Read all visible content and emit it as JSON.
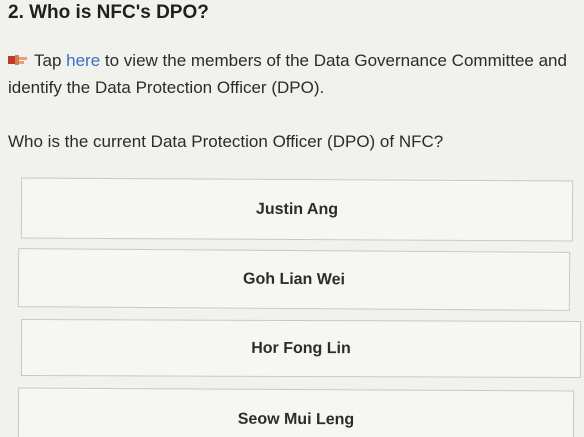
{
  "question": {
    "title": "2. Who is NFC's DPO?",
    "instruction_link": "here",
    "instruction_before": "Tap ",
    "instruction_after": " to view the members of the Data Governance Committee and identify the Data Protection Officer (DPO).",
    "prompt": "Who is the current Data Protection Officer (DPO) of NFC?"
  },
  "options": [
    "Justin Ang",
    "Goh Lian Wei",
    "Hor Fong Lin",
    "Seow Mui Leng"
  ],
  "icons": {
    "instruction_icon": "pointing-hand-icon"
  },
  "colors": {
    "link": "#3b6fc4"
  }
}
